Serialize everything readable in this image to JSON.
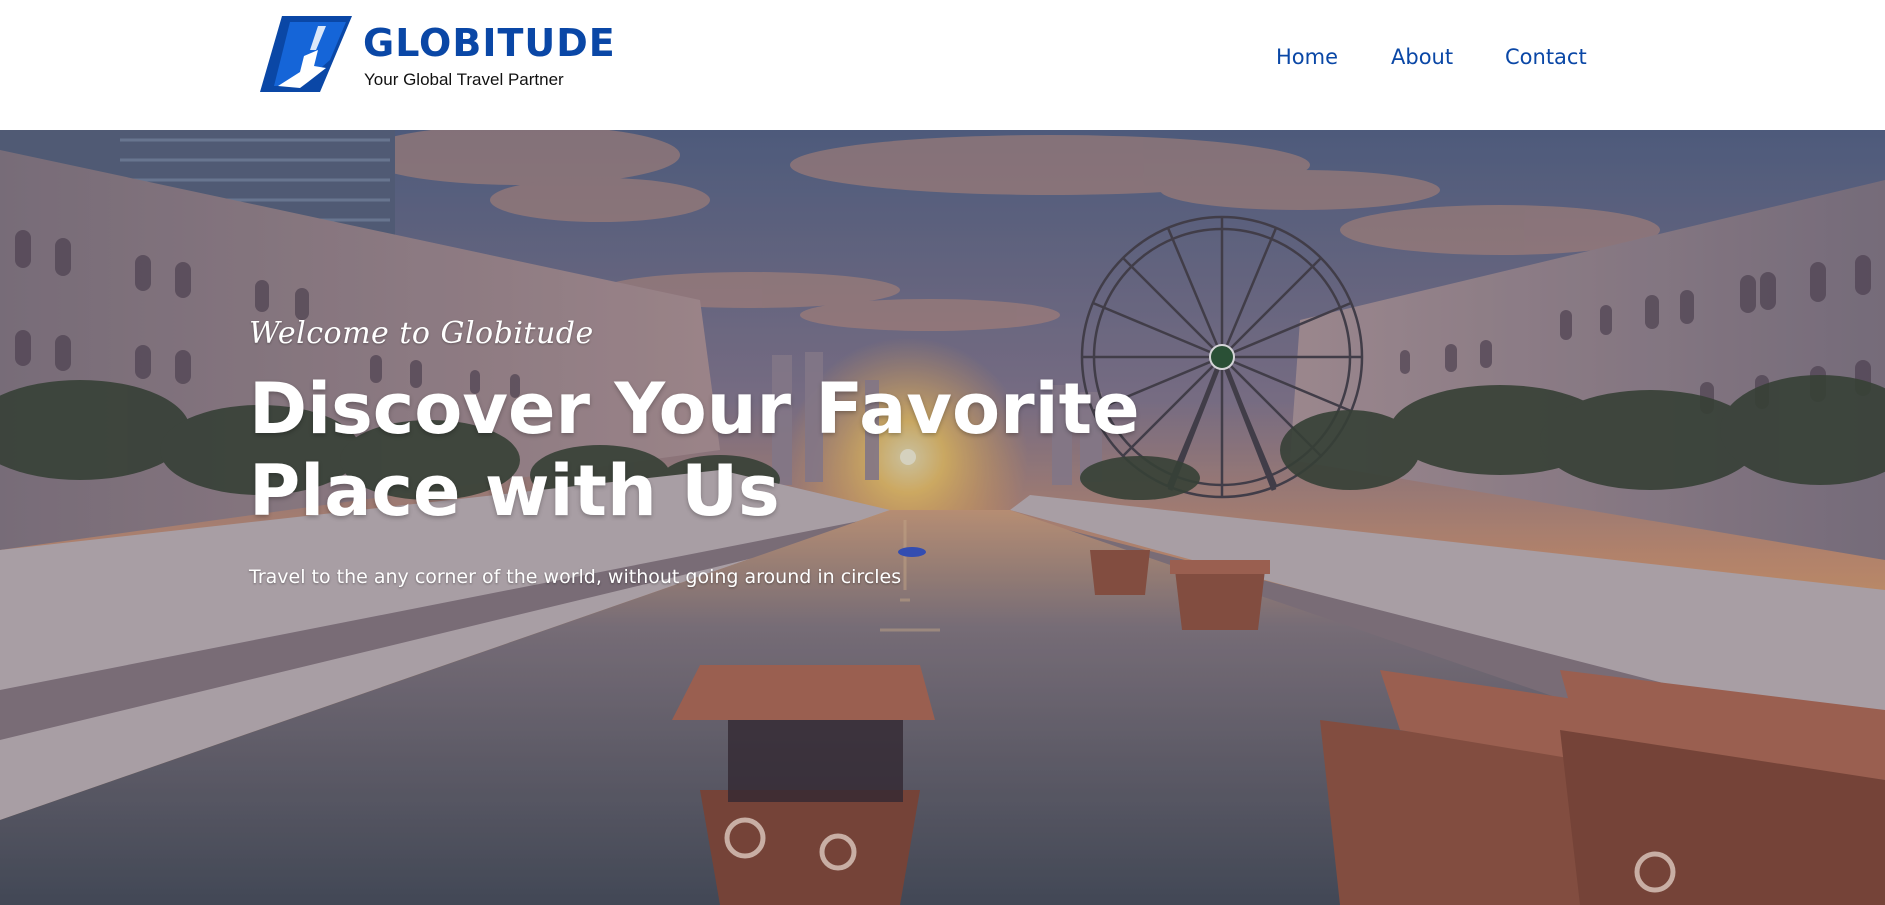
{
  "brand": {
    "name": "GLOBITUDE",
    "tagline": "Your Global Travel Partner",
    "color": "#0a47a6"
  },
  "nav": {
    "items": [
      {
        "label": "Home"
      },
      {
        "label": "About"
      },
      {
        "label": "Contact"
      }
    ]
  },
  "hero": {
    "welcome": "Welcome to Globitude",
    "title_line1": "Discover Your Favorite",
    "title_line2": "Place with Us",
    "subtitle": "Travel to the any corner of the world, without going around in circles"
  }
}
